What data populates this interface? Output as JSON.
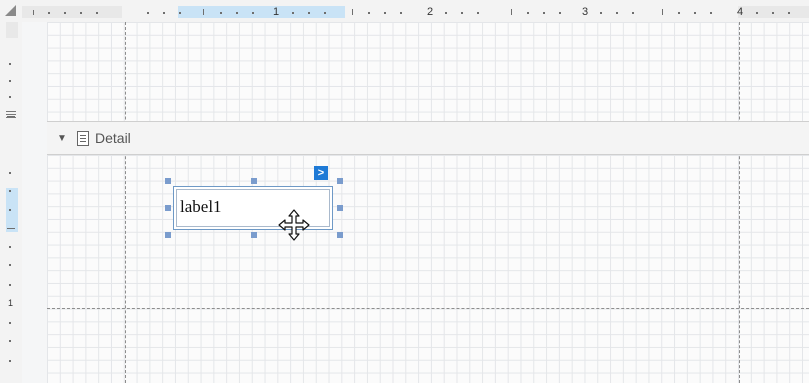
{
  "ruler": {
    "numbers": [
      "1",
      "2",
      "3",
      "4"
    ]
  },
  "band": {
    "title": "Detail",
    "expander_icon": "triangle-down-icon",
    "band_icon": "document-icon"
  },
  "control": {
    "text": "label1",
    "smart_tag": ">",
    "cursor_icon": "move-cursor-icon"
  },
  "colors": {
    "selection_handle": "#7a9ccd",
    "smart_tag": "#1e7ad6",
    "ruler_selection": "#c9e3f6"
  }
}
